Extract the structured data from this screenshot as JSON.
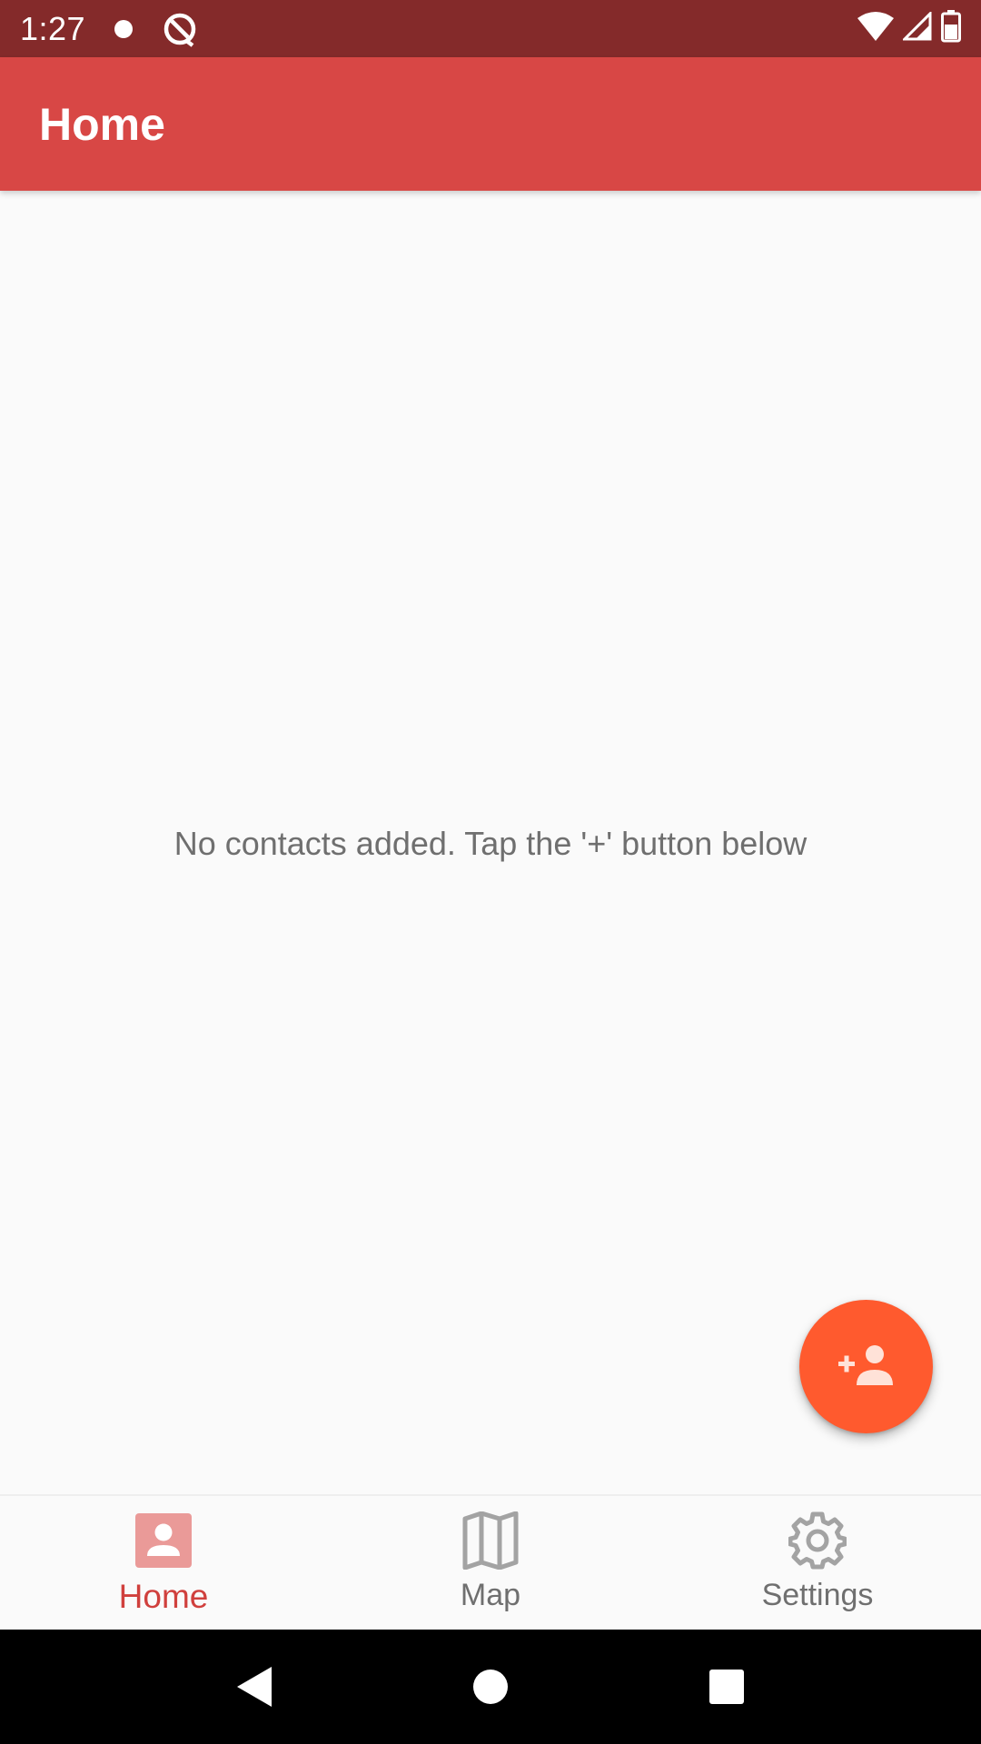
{
  "status_bar": {
    "time": "1:27",
    "icons": [
      "notification-dot-icon",
      "app-notification-icon",
      "wifi-icon",
      "cell-signal-icon",
      "battery-icon"
    ]
  },
  "app_bar": {
    "title": "Home",
    "color": "#d84745"
  },
  "main": {
    "empty_message": "No contacts added. Tap the '+' button below"
  },
  "fab": {
    "icon": "add-person-icon",
    "color": "#ff5a2e"
  },
  "bottom_nav": {
    "items": [
      {
        "label": "Home",
        "icon": "contact-card-icon",
        "active": true
      },
      {
        "label": "Map",
        "icon": "map-icon",
        "active": false
      },
      {
        "label": "Settings",
        "icon": "gear-icon",
        "active": false
      }
    ],
    "active_color": "#d0403d"
  },
  "system_nav": {
    "buttons": [
      "back-icon",
      "home-icon",
      "recents-icon"
    ]
  }
}
